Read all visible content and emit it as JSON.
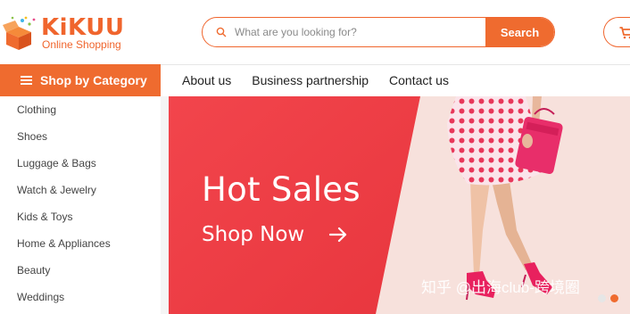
{
  "header": {
    "logo": {
      "name": "KiKUU",
      "tagline": "Online Shopping"
    },
    "search": {
      "placeholder": "What are you looking for?",
      "button_label": "Search"
    }
  },
  "category_menu": {
    "title": "Shop by Category",
    "items": [
      {
        "label": "Clothing"
      },
      {
        "label": "Shoes"
      },
      {
        "label": "Luggage & Bags"
      },
      {
        "label": "Watch & Jewelry"
      },
      {
        "label": "Kids & Toys"
      },
      {
        "label": "Home & Appliances"
      },
      {
        "label": "Beauty"
      },
      {
        "label": "Weddings"
      }
    ]
  },
  "nav": {
    "links": [
      {
        "label": "About us"
      },
      {
        "label": "Business partnership"
      },
      {
        "label": "Contact us"
      }
    ]
  },
  "banner": {
    "headline": "Hot Sales",
    "cta": "Shop Now",
    "watermark": "知乎 @出海club-跨境圈"
  },
  "colors": {
    "accent": "#ef6b2f",
    "banner_red": "#ee3e46",
    "banner_bg": "#f7e1dc"
  }
}
